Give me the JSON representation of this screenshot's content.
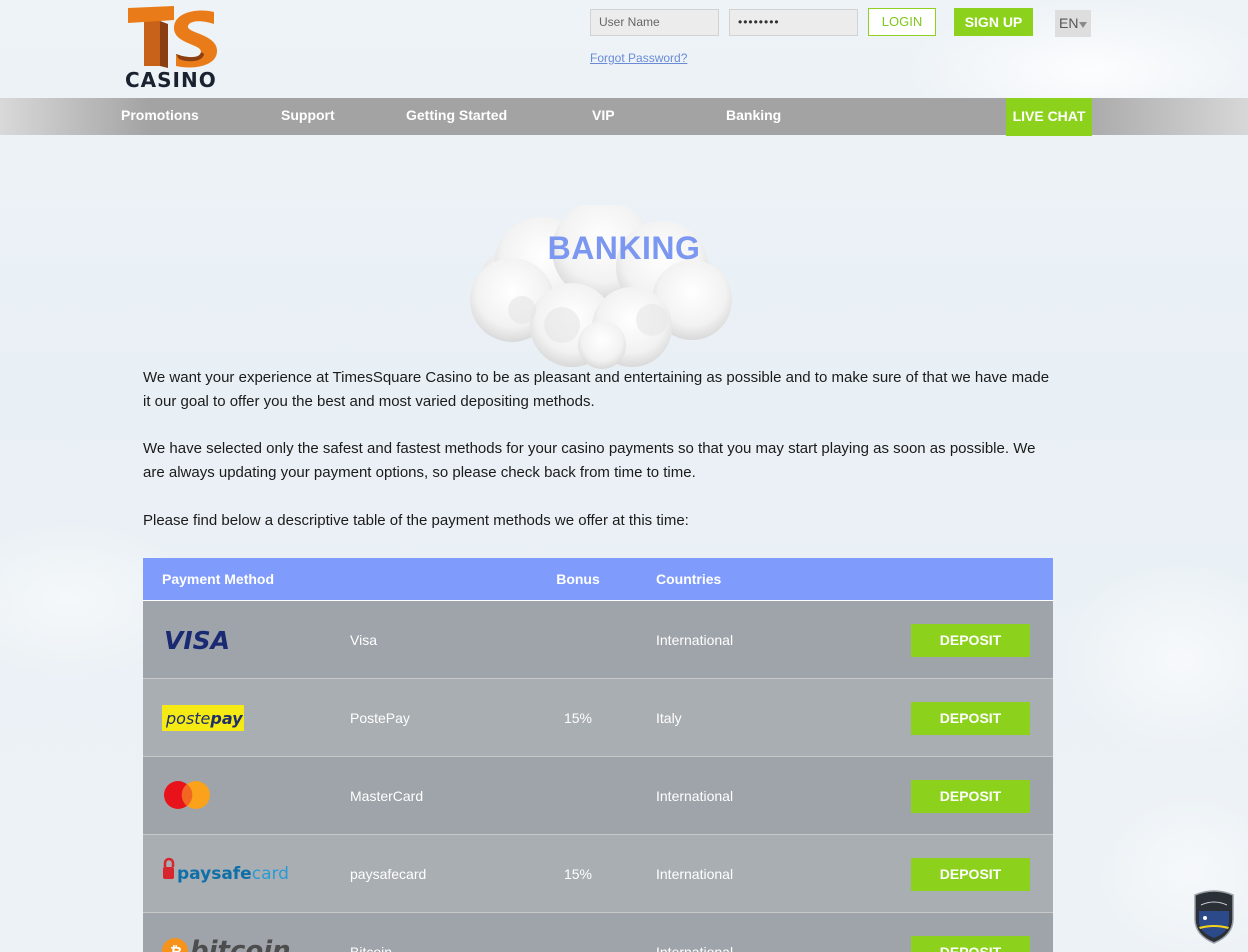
{
  "header": {
    "logo_text": "CASINO",
    "username_placeholder": "User Name",
    "password_masked": "••••••••",
    "login_label": "LOGIN",
    "signup_label": "SIGN UP",
    "language": "EN",
    "forgot_password": "Forgot Password?"
  },
  "nav": {
    "items": [
      {
        "label": "Promotions"
      },
      {
        "label": "Support"
      },
      {
        "label": "Getting Started"
      },
      {
        "label": "VIP"
      },
      {
        "label": "Banking"
      }
    ],
    "live_chat": "LIVE CHAT"
  },
  "page": {
    "title": "BANKING",
    "paragraphs": [
      "We want your experience at TimesSquare Casino to be as pleasant and entertaining as possible and to make sure of that we have made it our goal to offer you the best and most varied depositing methods.",
      "We have selected only the safest and fastest methods for your casino payments so that you may start playing as soon as possible. We are always updating your payment options, so please check back from time to time.",
      "Please find below a descriptive table of the payment methods we offer at this time:"
    ]
  },
  "table": {
    "headers": {
      "method": "Payment Method",
      "bonus": "Bonus",
      "countries": "Countries"
    },
    "rows": [
      {
        "logo": "VISA",
        "name": "Visa",
        "bonus": "",
        "country": "International",
        "action": "DEPOSIT"
      },
      {
        "logo": "postepay",
        "name": "PostePay",
        "bonus": "15%",
        "country": "Italy",
        "action": "DEPOSIT"
      },
      {
        "logo": "mastercard",
        "name": "MasterCard",
        "bonus": "",
        "country": "International",
        "action": "DEPOSIT"
      },
      {
        "logo": "paysafecard",
        "name": "paysafecard",
        "bonus": "15%",
        "country": "International",
        "action": "DEPOSIT"
      },
      {
        "logo": "bitcoin",
        "name": "Bitcoin",
        "bonus": "",
        "country": "International",
        "action": "DEPOSIT"
      }
    ]
  },
  "colors": {
    "accent_green": "#8cd21c",
    "header_blue": "#7f9bfb",
    "title_blue": "#7b97f0",
    "row_dark": "#9ea4aa",
    "row_light": "#a9aeb3"
  }
}
